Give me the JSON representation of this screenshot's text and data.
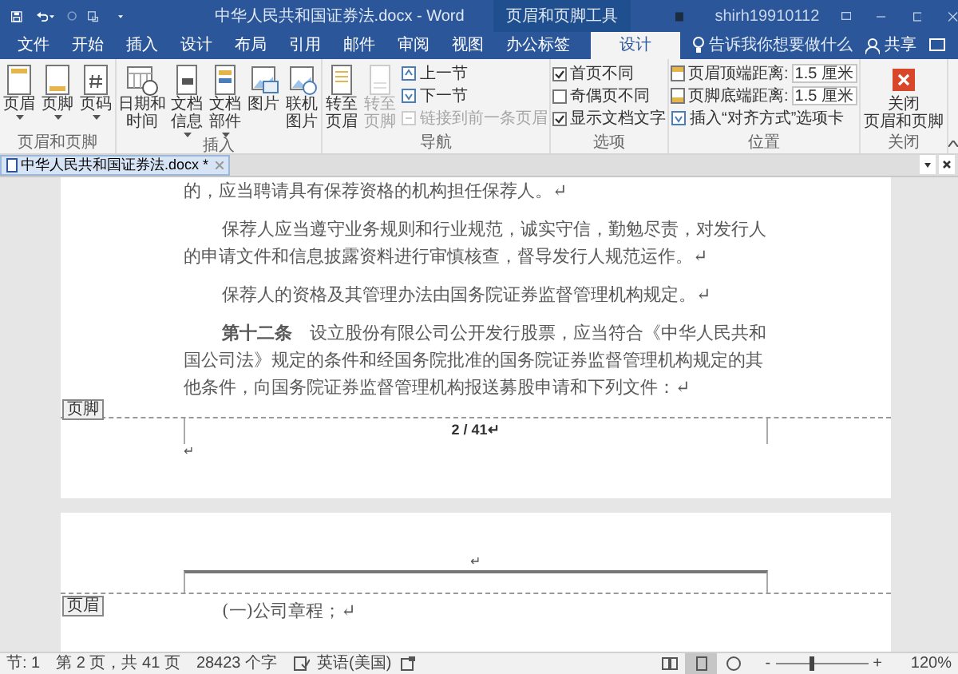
{
  "title_bar": {
    "title": "中华人民共和国证券法.docx - Word",
    "context_tools": "页眉和页脚工具",
    "user": "shirh19910112"
  },
  "menu_tabs": [
    {
      "label": "文件",
      "selected": false
    },
    {
      "label": "开始",
      "selected": false
    },
    {
      "label": "插入",
      "selected": false
    },
    {
      "label": "设计",
      "selected": false
    },
    {
      "label": "布局",
      "selected": false
    },
    {
      "label": "引用",
      "selected": false
    },
    {
      "label": "邮件",
      "selected": false
    },
    {
      "label": "审阅",
      "selected": false
    },
    {
      "label": "视图",
      "selected": false
    },
    {
      "label": "办公标签",
      "selected": false
    },
    {
      "label": "设计",
      "selected": true
    }
  ],
  "tell_me": "告诉我你想要做什么",
  "share": "共享",
  "ribbon_groups": [
    {
      "label": "页眉和页脚",
      "items": [
        {
          "kind": "large",
          "label": "页眉",
          "dropdown": true,
          "disabled": false
        },
        {
          "kind": "large",
          "label": "页脚",
          "dropdown": true,
          "disabled": false
        },
        {
          "kind": "large",
          "label": "页码",
          "dropdown": true,
          "disabled": false
        }
      ]
    },
    {
      "label": "插入",
      "items": [
        {
          "kind": "large",
          "label": "日期和时间",
          "dropdown": false,
          "disabled": false
        },
        {
          "kind": "large",
          "label": "文档信息",
          "dropdown": true,
          "disabled": false
        },
        {
          "kind": "large",
          "label": "文档部件",
          "dropdown": true,
          "disabled": false
        },
        {
          "kind": "large",
          "label": "图片",
          "dropdown": false,
          "disabled": false
        },
        {
          "kind": "large",
          "label": "联机图片",
          "dropdown": false,
          "disabled": false
        }
      ]
    },
    {
      "label": "导航",
      "items": [
        {
          "kind": "large",
          "label": "转至页眉",
          "dropdown": false,
          "disabled": false
        },
        {
          "kind": "large",
          "label": "转至页脚",
          "dropdown": false,
          "disabled": true
        },
        {
          "kind": "small",
          "label": "上一节",
          "disabled": false
        },
        {
          "kind": "small",
          "label": "下一节",
          "disabled": false
        },
        {
          "kind": "small",
          "label": "链接到前一条页眉",
          "disabled": true
        }
      ]
    },
    {
      "label": "选项",
      "items": [
        {
          "kind": "checkbox",
          "label": "首页不同",
          "checked": true
        },
        {
          "kind": "checkbox",
          "label": "奇偶页不同",
          "checked": false
        },
        {
          "kind": "checkbox",
          "label": "显示文档文字",
          "checked": true
        }
      ]
    },
    {
      "label": "位置",
      "items": [
        {
          "kind": "spin",
          "label": "页眉顶端距离:",
          "value": "1.5 厘米"
        },
        {
          "kind": "spin",
          "label": "页脚底端距离:",
          "value": "1.5 厘米"
        },
        {
          "kind": "small",
          "label": "插入“对齐方式”选项卡",
          "disabled": false
        }
      ]
    },
    {
      "label": "关闭",
      "items": [
        {
          "kind": "close",
          "label_lines": [
            "关闭",
            "页眉和页脚"
          ]
        }
      ]
    }
  ],
  "document_tab": {
    "label": "中华人民共和国证券法.docx *",
    "selected": true
  },
  "pages": [
    {
      "paragraphs": [
        {
          "text": "的，应当聘请具有保荐资格的机构担任保荐人。↵",
          "indent": false
        },
        {
          "text": "保荐人应当遵守业务规则和行业规范，诚实守信，勤勉尽责，对发行人的申请文件和信息披露资料进行审慎核查，督导发行人规范运作。↵",
          "indent": true
        },
        {
          "text": "保荐人的资格及其管理办法由国务院证券监督管理机构规定。↵",
          "indent": true
        },
        {
          "text": "**第十二条**　设立股份有限公司公开发行股票，应当符合《中华人民共和国公司法》规定的条件和经国务院批准的国务院证券监督管理机构规定的其他条件，向国务院证券监督管理机构报送募股申请和下列文件：↵",
          "indent": true
        }
      ],
      "footer_tag": "页脚",
      "page_number": "2 / 41↵",
      "footer_mark": "↵"
    },
    {
      "header_mark": "↵",
      "header_tag": "页眉",
      "paragraphs": [
        {
          "text": "(一)公司章程；↵",
          "indent": true
        }
      ]
    }
  ],
  "status_bar": {
    "section": "节: 1",
    "page": "第 2 页，共 41 页",
    "words": "28423 个字",
    "language": "英语(美国)",
    "views": [
      {
        "selected": false
      },
      {
        "selected": true
      },
      {
        "selected": false
      }
    ],
    "zoom": {
      "minus": "-",
      "plus": "+",
      "level": 0.38,
      "reading": "120%"
    }
  }
}
